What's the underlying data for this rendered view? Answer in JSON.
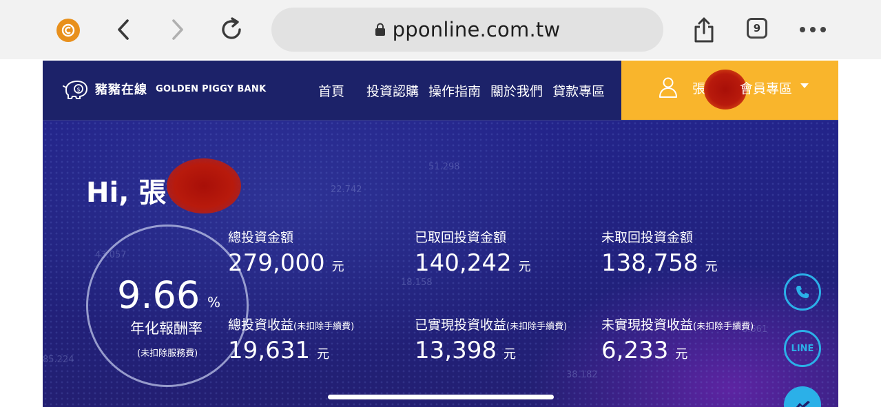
{
  "browser": {
    "url": "pponline.com.tw",
    "tab_count": "9",
    "icons": {
      "brand": "circle-c-icon",
      "back": "chevron-left-icon",
      "forward": "chevron-right-icon",
      "reload": "reload-icon",
      "lock": "lock-icon",
      "share": "share-icon",
      "tabs": "tabs-icon",
      "more": "more-dots-icon"
    }
  },
  "site": {
    "logo_cn": "豬豬在線",
    "logo_en": "GOLDEN PIGGY BANK",
    "menu": [
      {
        "label": "首頁"
      },
      {
        "label": "投資認購"
      },
      {
        "label": "操作指南"
      },
      {
        "label": "關於我們"
      },
      {
        "label": "貸款專區"
      }
    ],
    "member": {
      "name_prefix": "張",
      "label": "會員專區",
      "accent": "#f9b52c"
    }
  },
  "dashboard": {
    "greeting": "Hi, 張",
    "rate": {
      "value": "9.66",
      "unit": "%",
      "label": "年化報酬率",
      "note": "(未扣除服務費)"
    },
    "stats": [
      {
        "label": "總投資金額",
        "note": "",
        "value": "279,000",
        "unit": "元"
      },
      {
        "label": "已取回投資金額",
        "note": "",
        "value": "140,242",
        "unit": "元"
      },
      {
        "label": "未取回投資金額",
        "note": "",
        "value": "138,758",
        "unit": "元"
      },
      {
        "label": "總投資收益",
        "note": "(未扣除手續費)",
        "value": "19,631",
        "unit": "元"
      },
      {
        "label": "已實現投資收益",
        "note": "(未扣除手續費)",
        "value": "13,398",
        "unit": "元"
      },
      {
        "label": "未實現投資收益",
        "note": "(未扣除手續費)",
        "value": "6,233",
        "unit": "元"
      }
    ],
    "floating": {
      "line_label": "LINE"
    }
  },
  "colors": {
    "page_bg": "#1e1f6b",
    "member_bg": "#f9b52c",
    "float_accent": "#2bb0e8",
    "brand_icon": "#e8901c"
  }
}
